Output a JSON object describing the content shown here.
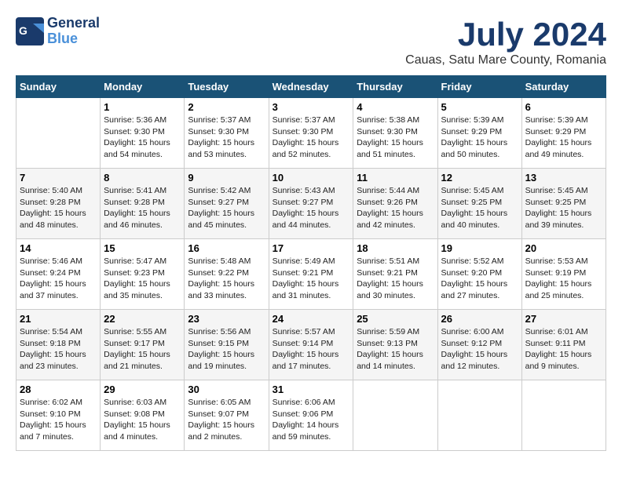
{
  "header": {
    "logo_general": "General",
    "logo_blue": "Blue",
    "month": "July 2024",
    "location": "Cauas, Satu Mare County, Romania"
  },
  "weekdays": [
    "Sunday",
    "Monday",
    "Tuesday",
    "Wednesday",
    "Thursday",
    "Friday",
    "Saturday"
  ],
  "weeks": [
    [
      {
        "day": "",
        "info": ""
      },
      {
        "day": "1",
        "info": "Sunrise: 5:36 AM\nSunset: 9:30 PM\nDaylight: 15 hours\nand 54 minutes."
      },
      {
        "day": "2",
        "info": "Sunrise: 5:37 AM\nSunset: 9:30 PM\nDaylight: 15 hours\nand 53 minutes."
      },
      {
        "day": "3",
        "info": "Sunrise: 5:37 AM\nSunset: 9:30 PM\nDaylight: 15 hours\nand 52 minutes."
      },
      {
        "day": "4",
        "info": "Sunrise: 5:38 AM\nSunset: 9:30 PM\nDaylight: 15 hours\nand 51 minutes."
      },
      {
        "day": "5",
        "info": "Sunrise: 5:39 AM\nSunset: 9:29 PM\nDaylight: 15 hours\nand 50 minutes."
      },
      {
        "day": "6",
        "info": "Sunrise: 5:39 AM\nSunset: 9:29 PM\nDaylight: 15 hours\nand 49 minutes."
      }
    ],
    [
      {
        "day": "7",
        "info": "Sunrise: 5:40 AM\nSunset: 9:28 PM\nDaylight: 15 hours\nand 48 minutes."
      },
      {
        "day": "8",
        "info": "Sunrise: 5:41 AM\nSunset: 9:28 PM\nDaylight: 15 hours\nand 46 minutes."
      },
      {
        "day": "9",
        "info": "Sunrise: 5:42 AM\nSunset: 9:27 PM\nDaylight: 15 hours\nand 45 minutes."
      },
      {
        "day": "10",
        "info": "Sunrise: 5:43 AM\nSunset: 9:27 PM\nDaylight: 15 hours\nand 44 minutes."
      },
      {
        "day": "11",
        "info": "Sunrise: 5:44 AM\nSunset: 9:26 PM\nDaylight: 15 hours\nand 42 minutes."
      },
      {
        "day": "12",
        "info": "Sunrise: 5:45 AM\nSunset: 9:25 PM\nDaylight: 15 hours\nand 40 minutes."
      },
      {
        "day": "13",
        "info": "Sunrise: 5:45 AM\nSunset: 9:25 PM\nDaylight: 15 hours\nand 39 minutes."
      }
    ],
    [
      {
        "day": "14",
        "info": "Sunrise: 5:46 AM\nSunset: 9:24 PM\nDaylight: 15 hours\nand 37 minutes."
      },
      {
        "day": "15",
        "info": "Sunrise: 5:47 AM\nSunset: 9:23 PM\nDaylight: 15 hours\nand 35 minutes."
      },
      {
        "day": "16",
        "info": "Sunrise: 5:48 AM\nSunset: 9:22 PM\nDaylight: 15 hours\nand 33 minutes."
      },
      {
        "day": "17",
        "info": "Sunrise: 5:49 AM\nSunset: 9:21 PM\nDaylight: 15 hours\nand 31 minutes."
      },
      {
        "day": "18",
        "info": "Sunrise: 5:51 AM\nSunset: 9:21 PM\nDaylight: 15 hours\nand 30 minutes."
      },
      {
        "day": "19",
        "info": "Sunrise: 5:52 AM\nSunset: 9:20 PM\nDaylight: 15 hours\nand 27 minutes."
      },
      {
        "day": "20",
        "info": "Sunrise: 5:53 AM\nSunset: 9:19 PM\nDaylight: 15 hours\nand 25 minutes."
      }
    ],
    [
      {
        "day": "21",
        "info": "Sunrise: 5:54 AM\nSunset: 9:18 PM\nDaylight: 15 hours\nand 23 minutes."
      },
      {
        "day": "22",
        "info": "Sunrise: 5:55 AM\nSunset: 9:17 PM\nDaylight: 15 hours\nand 21 minutes."
      },
      {
        "day": "23",
        "info": "Sunrise: 5:56 AM\nSunset: 9:15 PM\nDaylight: 15 hours\nand 19 minutes."
      },
      {
        "day": "24",
        "info": "Sunrise: 5:57 AM\nSunset: 9:14 PM\nDaylight: 15 hours\nand 17 minutes."
      },
      {
        "day": "25",
        "info": "Sunrise: 5:59 AM\nSunset: 9:13 PM\nDaylight: 15 hours\nand 14 minutes."
      },
      {
        "day": "26",
        "info": "Sunrise: 6:00 AM\nSunset: 9:12 PM\nDaylight: 15 hours\nand 12 minutes."
      },
      {
        "day": "27",
        "info": "Sunrise: 6:01 AM\nSunset: 9:11 PM\nDaylight: 15 hours\nand 9 minutes."
      }
    ],
    [
      {
        "day": "28",
        "info": "Sunrise: 6:02 AM\nSunset: 9:10 PM\nDaylight: 15 hours\nand 7 minutes."
      },
      {
        "day": "29",
        "info": "Sunrise: 6:03 AM\nSunset: 9:08 PM\nDaylight: 15 hours\nand 4 minutes."
      },
      {
        "day": "30",
        "info": "Sunrise: 6:05 AM\nSunset: 9:07 PM\nDaylight: 15 hours\nand 2 minutes."
      },
      {
        "day": "31",
        "info": "Sunrise: 6:06 AM\nSunset: 9:06 PM\nDaylight: 14 hours\nand 59 minutes."
      },
      {
        "day": "",
        "info": ""
      },
      {
        "day": "",
        "info": ""
      },
      {
        "day": "",
        "info": ""
      }
    ]
  ]
}
